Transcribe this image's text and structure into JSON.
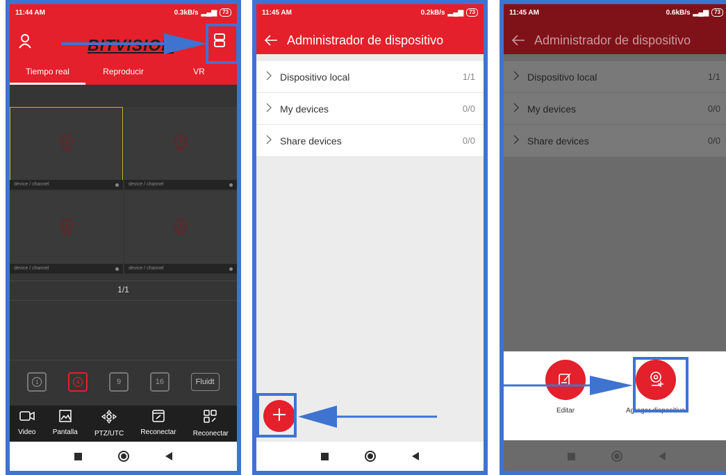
{
  "panel1": {
    "status": {
      "time": "11:44 AM",
      "speed": "0.3kB/s",
      "battery": "73"
    },
    "header": {
      "logo": "BITVISION"
    },
    "tabs": [
      {
        "label": "Tiempo real"
      },
      {
        "label": "Reproducir"
      },
      {
        "label": "VR"
      }
    ],
    "cells": [
      {
        "label": "device / channel"
      },
      {
        "label": "device / channel"
      },
      {
        "label": "device / channel"
      },
      {
        "label": "device / channel"
      }
    ],
    "page_indicator": "1/1",
    "layouts": [
      "1",
      "4",
      "9",
      "16"
    ],
    "fluidt_label": "Fluidt",
    "toolbar": [
      {
        "label": "Video",
        "icon": "video-icon"
      },
      {
        "label": "Pantalla",
        "icon": "screenshot-icon"
      },
      {
        "label": "PTZ/UTC",
        "icon": "ptz-icon"
      },
      {
        "label": "Reconectar",
        "icon": "reconnect-icon"
      },
      {
        "label": "Reconectar",
        "icon": "reconnect-all-icon"
      }
    ]
  },
  "panel2": {
    "status": {
      "time": "11:45 AM",
      "speed": "0.2kB/s",
      "battery": "73"
    },
    "title": "Administrador de dispositivo",
    "rows": [
      {
        "label": "Dispositivo local",
        "count": "1/1"
      },
      {
        "label": "My devices",
        "count": "0/0"
      },
      {
        "label": "Share devices",
        "count": "0/0"
      }
    ]
  },
  "panel3": {
    "status": {
      "time": "11:45 AM",
      "speed": "0.6kB/s",
      "battery": "73"
    },
    "title": "Administrador de dispositivo",
    "rows": [
      {
        "label": "Dispositivo local",
        "count": "1/1"
      },
      {
        "label": "My devices",
        "count": "0/0"
      },
      {
        "label": "Share devices",
        "count": "0/0"
      }
    ],
    "sheet": {
      "edit_label": "Editar",
      "add_label": "Agregar dispositivo"
    }
  },
  "colors": {
    "brand_red": "#e3202b",
    "highlight_blue": "#3f73d0"
  }
}
